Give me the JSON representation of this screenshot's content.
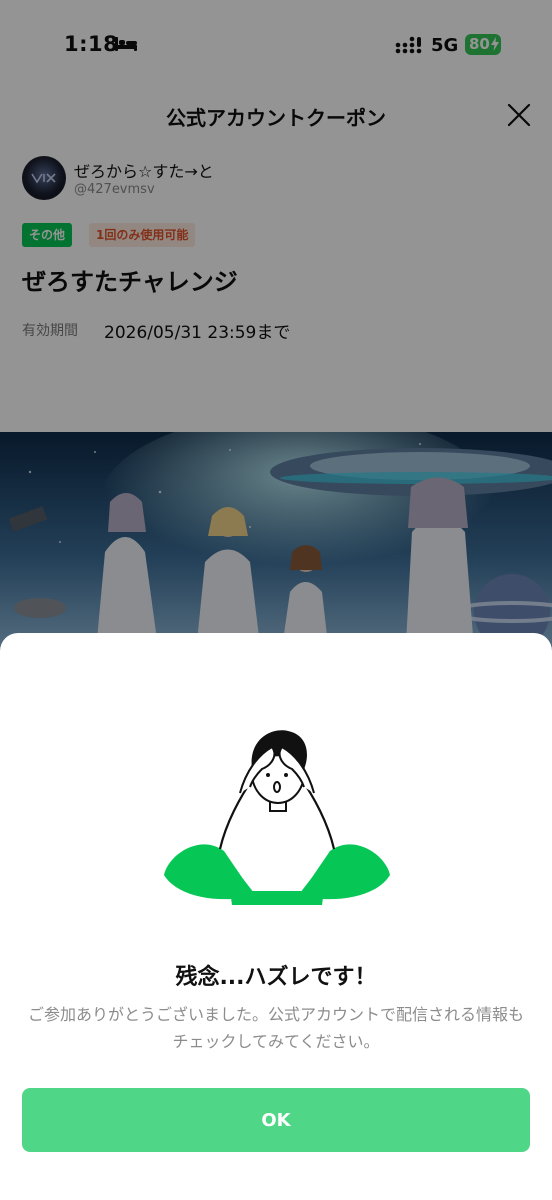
{
  "status_bar": {
    "time": "1:18",
    "network": "5G",
    "battery": "80",
    "icons": [
      "bed-icon",
      "signal-icon",
      "battery-icon",
      "bolt-icon"
    ]
  },
  "header": {
    "title": "公式アカウントクーポン",
    "close_icon": "close-icon"
  },
  "account": {
    "name": "ぜろから☆すた→と",
    "id": "@427evmsv"
  },
  "coupon": {
    "tags": [
      "その他",
      "1回のみ使用可能"
    ],
    "title": "ぜろすたチャレンジ",
    "validity_label": "有効期間",
    "validity_value": "2026/05/31 23:59まで"
  },
  "result_sheet": {
    "title": "残念...ハズレです！",
    "message": "ご参加ありがとうございました。公式アカウントで配信される情報もチェックしてみてください。",
    "ok_label": "OK"
  },
  "colors": {
    "line_green": "#06c755",
    "ok_button": "#4fd787",
    "usage_tag_text": "#e0532a",
    "usage_tag_bg": "#fde9e0",
    "battery": "#34c759"
  }
}
